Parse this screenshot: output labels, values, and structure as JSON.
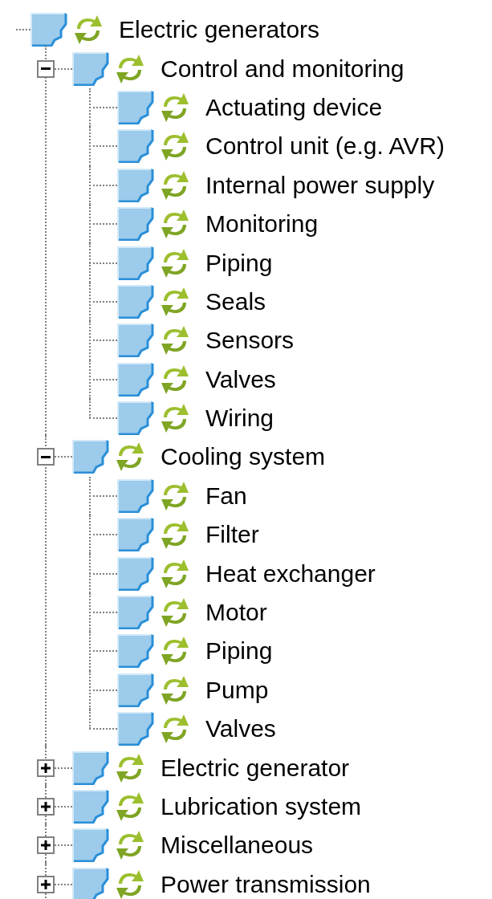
{
  "tree": {
    "items": [
      {
        "label": "Electric generators",
        "children": [
          {
            "label": "Control and monitoring",
            "expanded": true,
            "children": [
              {
                "label": "Actuating device"
              },
              {
                "label": "Control unit (e.g. AVR)"
              },
              {
                "label": "Internal power supply"
              },
              {
                "label": "Monitoring"
              },
              {
                "label": "Piping"
              },
              {
                "label": "Seals"
              },
              {
                "label": "Sensors"
              },
              {
                "label": "Valves"
              },
              {
                "label": "Wiring"
              }
            ]
          },
          {
            "label": "Cooling system",
            "expanded": true,
            "children": [
              {
                "label": "Fan"
              },
              {
                "label": "Filter"
              },
              {
                "label": "Heat exchanger"
              },
              {
                "label": "Motor"
              },
              {
                "label": "Piping"
              },
              {
                "label": "Pump"
              },
              {
                "label": "Valves"
              }
            ]
          },
          {
            "label": "Electric generator",
            "expanded": false
          },
          {
            "label": "Lubrication system",
            "expanded": false
          },
          {
            "label": "Miscellaneous",
            "expanded": false
          },
          {
            "label": "Power transmission",
            "expanded": false
          }
        ]
      }
    ]
  }
}
